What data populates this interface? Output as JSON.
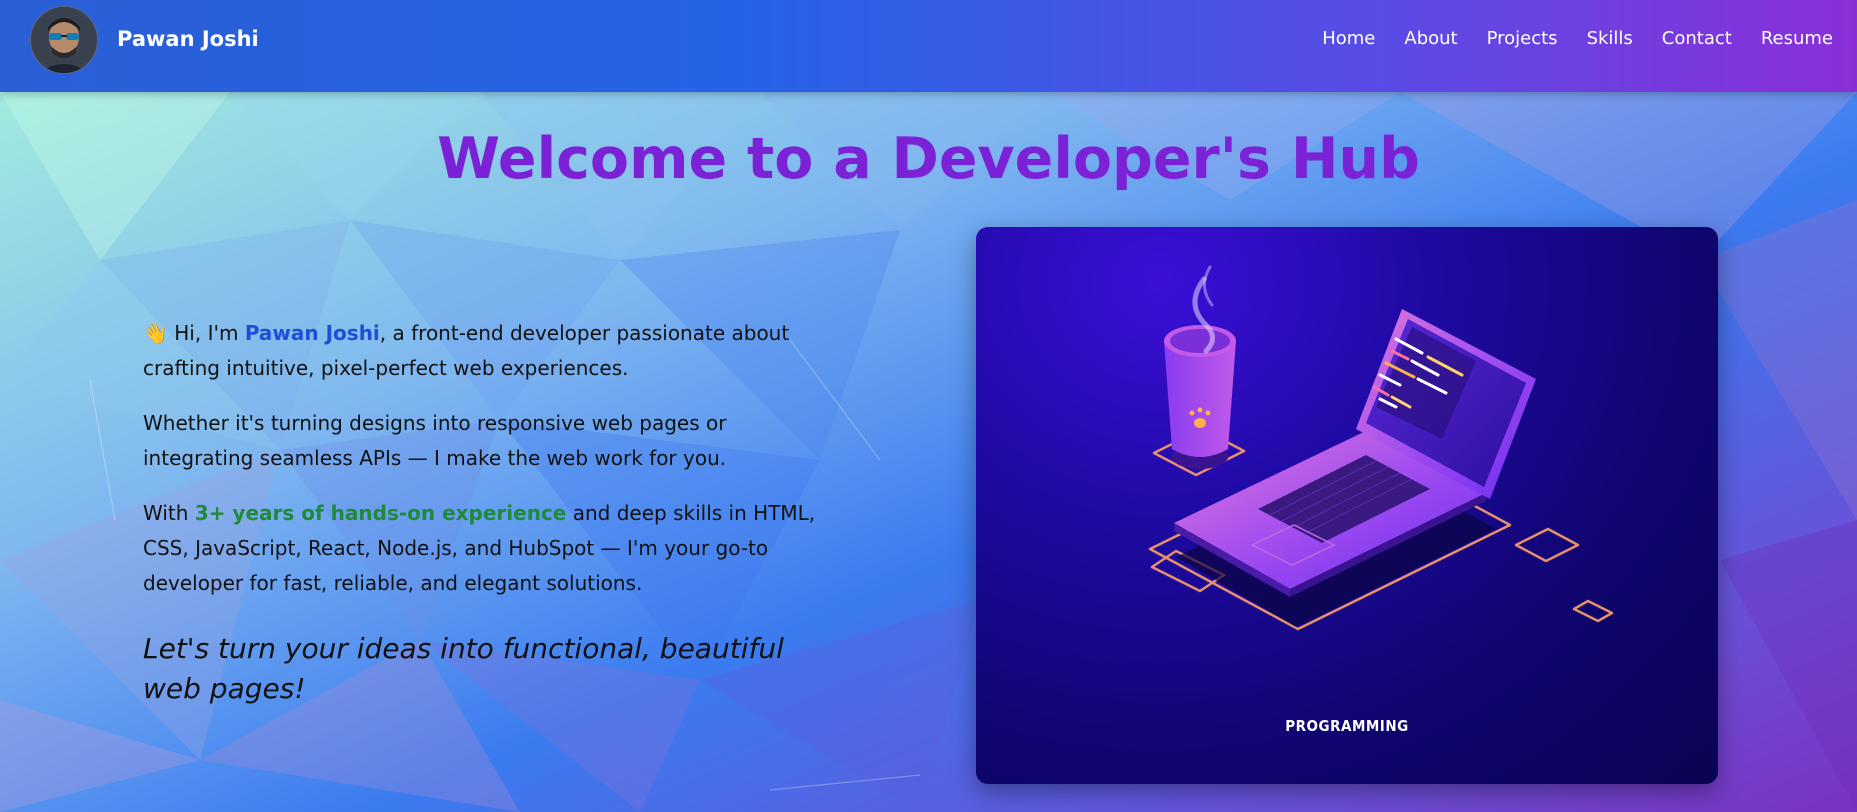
{
  "header": {
    "brand_name": "Pawan Joshi",
    "nav": [
      "Home",
      "About",
      "Projects",
      "Skills",
      "Contact",
      "Resume"
    ]
  },
  "hero": {
    "title": "Welcome to a Developer's Hub",
    "intro_wave": "👋",
    "intro_pre": " Hi, I'm ",
    "intro_name": "Pawan Joshi",
    "intro_post": ", a front-end developer passionate about crafting intuitive, pixel-perfect web experiences.",
    "paragraph2": "Whether it's turning designs into responsive web pages or integrating seamless APIs — I make the web work for you.",
    "p3_pre": "With ",
    "p3_highlight": "3+ years of hands-on experience",
    "p3_post": " and deep skills in HTML, CSS, JavaScript, React, Node.js, and HubSpot — I'm your go-to developer for fast, reliable, and elegant solutions.",
    "tagline": "Let's turn your ideas into functional, beautiful web pages!"
  },
  "illustration": {
    "label": "PROGRAMMING"
  },
  "colors": {
    "title": "#7b22d6",
    "name_highlight": "#1f4fd6",
    "experience_highlight": "#1f8a3a",
    "card_bg": "#0f056d"
  }
}
